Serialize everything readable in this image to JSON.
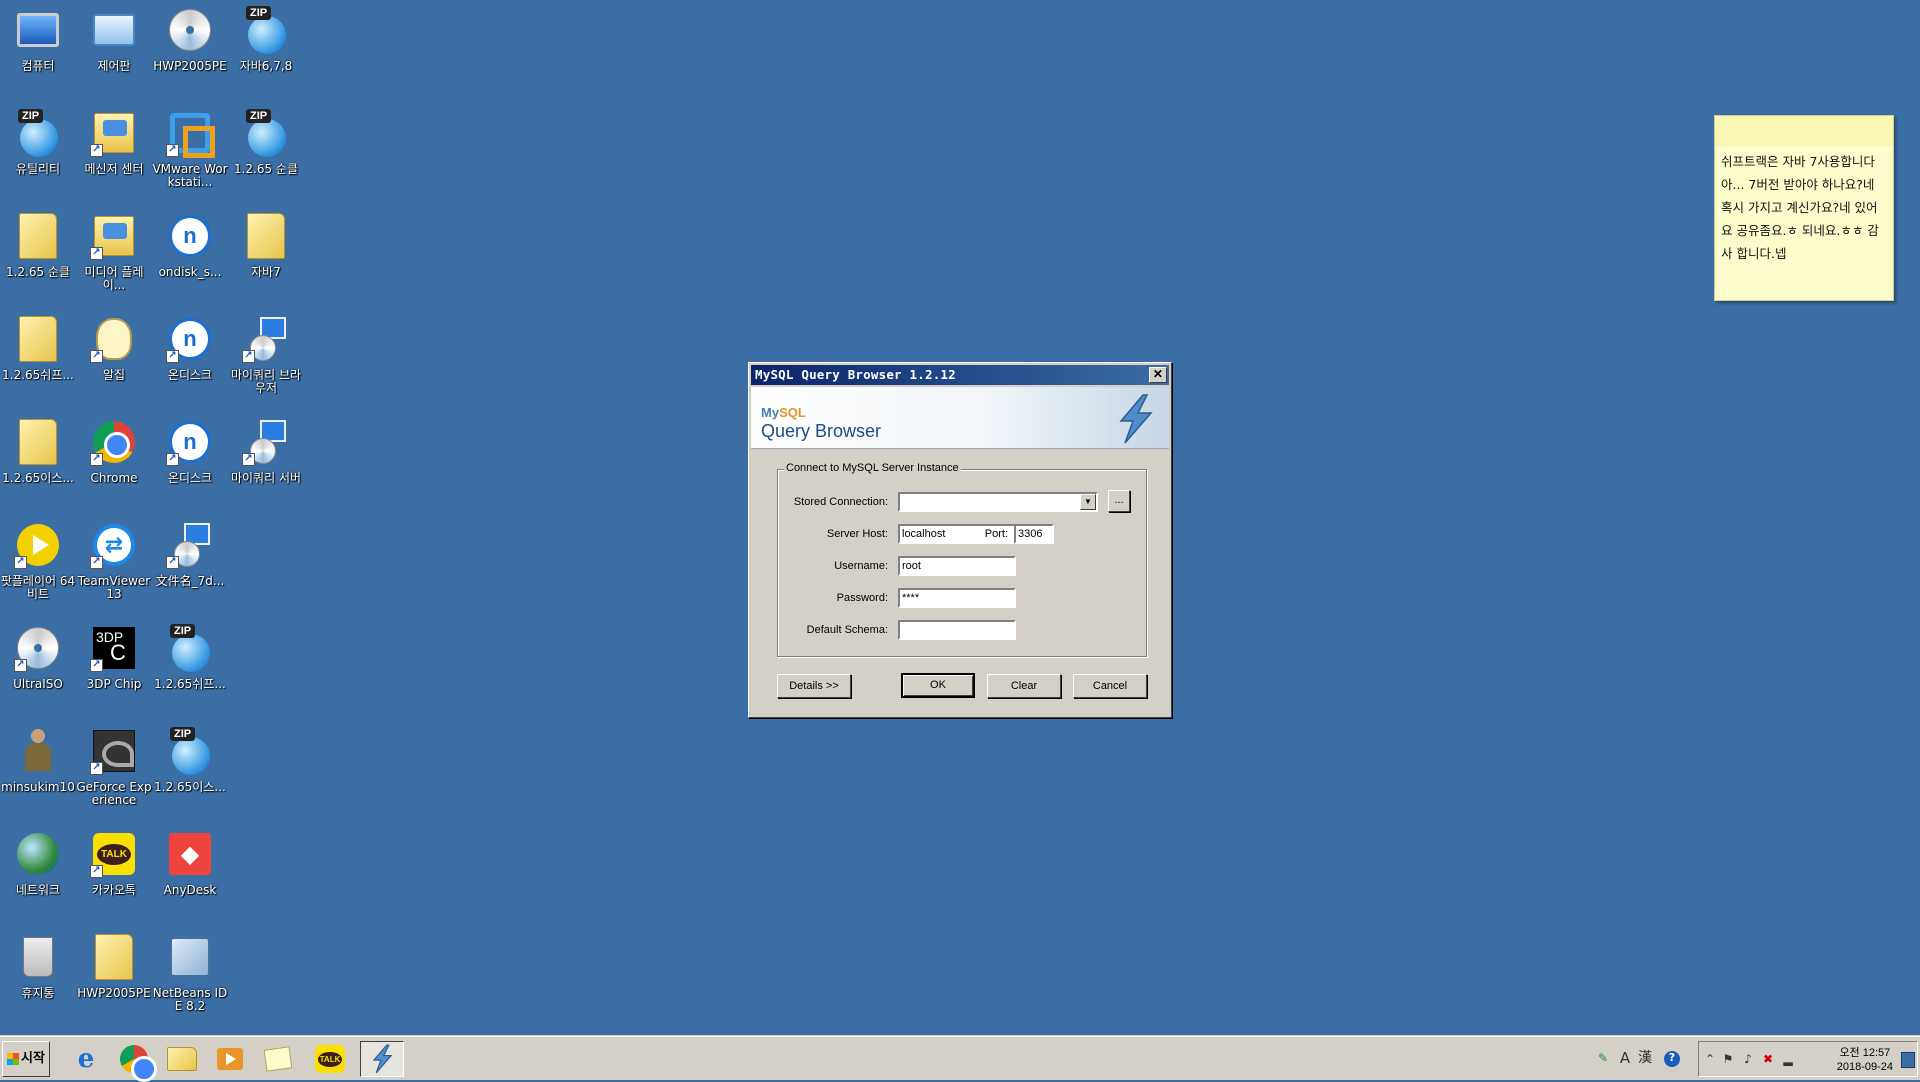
{
  "desktop": {
    "icons": [
      {
        "label": "컴퓨터"
      },
      {
        "label": "제어판"
      },
      {
        "label": "HWP2005PE"
      },
      {
        "label": "자바6,7,8"
      },
      {
        "label": "유틸리티"
      },
      {
        "label": "메신저 센터"
      },
      {
        "label": "VMware Workstati..."
      },
      {
        "label": "1.2.65 순클"
      },
      {
        "label": "1.2.65 순클"
      },
      {
        "label": "미디어 플레이..."
      },
      {
        "label": "ondisk_s..."
      },
      {
        "label": "자바7"
      },
      {
        "label": "1.2.65쉬프..."
      },
      {
        "label": "알집"
      },
      {
        "label": "온디스크"
      },
      {
        "label": "마이쿼리 브라우저"
      },
      {
        "label": "1.2.65이스..."
      },
      {
        "label": "Chrome"
      },
      {
        "label": "온디스크"
      },
      {
        "label": "마이쿼리 서버"
      },
      {
        "label": "팟플레이어 64 비트"
      },
      {
        "label": "TeamViewer 13"
      },
      {
        "label": "文件名_7d..."
      },
      {
        "label": "UltraISO"
      },
      {
        "label": "3DP Chip"
      },
      {
        "label": "1.2.65쉬프..."
      },
      {
        "label": "minsukim10"
      },
      {
        "label": "GeForce Experience"
      },
      {
        "label": "1.2.65이스..."
      },
      {
        "label": "네트워크"
      },
      {
        "label": "카카오톡"
      },
      {
        "label": "AnyDesk"
      },
      {
        "label": "휴지통"
      },
      {
        "label": "HWP2005PE"
      },
      {
        "label": "NetBeans IDE 8.2"
      }
    ],
    "badges": {
      "zip": "ZIP",
      "talk": "TALK",
      "chip": "3DP",
      "chip_c": "C",
      "ondisk": "n",
      "teamviewer": "⇄",
      "anydesk": "◆"
    }
  },
  "sticky_note": {
    "text": "쉬프트랙은 자바 7사용합니다 아... 7버전 받아야 하나요?네 혹시 가지고 계신가요?네 있어요 공유좀요.ㅎ 되네요.ㅎㅎ 감사 합니다.넵"
  },
  "dialog": {
    "title": "MySQL Query Browser 1.2.12",
    "close_glyph": "✕",
    "logo_text": "MySQL",
    "logo_text_a": "My",
    "logo_text_b": "SQL",
    "product_name": "Query Browser",
    "group_title": "Connect to MySQL Server Instance",
    "stored_connection_label": "Stored Connection:",
    "stored_connection_value": "",
    "browse_button": "...",
    "server_host_label": "Server Host:",
    "server_host_value": "localhost",
    "port_label": "Port:",
    "port_value": "3306",
    "username_label": "Username:",
    "username_value": "root",
    "password_label": "Password:",
    "password_value": "****",
    "default_schema_label": "Default Schema:",
    "default_schema_value": "",
    "details_button": "Details >>",
    "ok_button": "OK",
    "clear_button": "Clear",
    "cancel_button": "Cancel"
  },
  "taskbar": {
    "start_label": "시작",
    "clock_time": "오전 12:57",
    "clock_date": "2018-09-24",
    "ime_a": "A",
    "ime_han": "漢"
  },
  "colors": {
    "desktop": "#3a6ea5",
    "titlebar_start": "#0a246a",
    "titlebar_end": "#3a6ea5",
    "sticky": "#fdfdcb"
  }
}
